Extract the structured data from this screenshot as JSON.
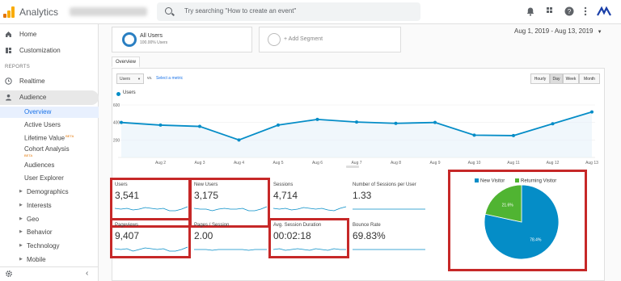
{
  "app": {
    "name": "Analytics"
  },
  "search": {
    "placeholder": "Try searching \"How to create an event\""
  },
  "sidebar": {
    "home": "Home",
    "customization": "Customization",
    "reports_heading": "REPORTS",
    "realtime": "Realtime",
    "audience": "Audience",
    "audience_items": [
      {
        "label": "Overview"
      },
      {
        "label": "Active Users"
      },
      {
        "label": "Lifetime Value",
        "badge": "BETA"
      },
      {
        "label": "Cohort Analysis",
        "badge": "BETA"
      },
      {
        "label": "Audiences"
      },
      {
        "label": "User Explorer"
      },
      {
        "label": "Demographics"
      },
      {
        "label": "Interests"
      },
      {
        "label": "Geo"
      },
      {
        "label": "Behavior"
      },
      {
        "label": "Technology"
      },
      {
        "label": "Mobile"
      }
    ]
  },
  "segments": {
    "all_users": "All Users",
    "all_users_pct": "100.00% Users",
    "add_segment": "+ Add Segment"
  },
  "date_range": "Aug 1, 2019 - Aug 13, 2019",
  "tab_label": "Overview",
  "controls": {
    "metric_dropdown": "Users",
    "vs": "vs.",
    "select_metric": "Select a metric",
    "granularity": [
      "Hourly",
      "Day",
      "Week",
      "Month"
    ],
    "active_granularity": "Day"
  },
  "chart_data": {
    "type": "line",
    "series": [
      {
        "name": "Users",
        "values": [
          400,
          370,
          355,
          200,
          370,
          435,
          405,
          390,
          400,
          255,
          250,
          385,
          520
        ]
      }
    ],
    "x": [
      "Aug 1",
      "Aug 2",
      "Aug 3",
      "Aug 4",
      "Aug 5",
      "Aug 6",
      "Aug 7",
      "Aug 8",
      "Aug 9",
      "Aug 10",
      "Aug 11",
      "Aug 12",
      "Aug 13"
    ],
    "x_tick_labels": [
      "",
      "Aug 2",
      "Aug 3",
      "Aug 4",
      "Aug 5",
      "Aug 6",
      "Aug 7",
      "Aug 8",
      "Aug 9",
      "Aug 10",
      "Aug 11",
      "Aug 12",
      "Aug 13"
    ],
    "y_ticks": [
      600,
      400,
      200
    ],
    "ylim": [
      0,
      600
    ],
    "color": "#058dc7"
  },
  "metrics": [
    {
      "label": "Users",
      "value": "3,541",
      "highlighted": true
    },
    {
      "label": "New Users",
      "value": "3,175",
      "highlighted": true
    },
    {
      "label": "Sessions",
      "value": "4,714",
      "highlighted": false
    },
    {
      "label": "Number of Sessions per User",
      "value": "1.33",
      "highlighted": false
    },
    {
      "label": "Pageviews",
      "value": "9,407",
      "highlighted": true
    },
    {
      "label": "Pages / Session",
      "value": "2.00",
      "highlighted": false
    },
    {
      "label": "Avg. Session Duration",
      "value": "00:02:18",
      "highlighted": true
    },
    {
      "label": "Bounce Rate",
      "value": "69.83%",
      "highlighted": false
    }
  ],
  "pie": {
    "legend": [
      {
        "label": "New Visitor",
        "color": "#058dc7"
      },
      {
        "label": "Returning Visitor",
        "color": "#50b432"
      }
    ],
    "slices": [
      {
        "label": "New Visitor",
        "value": 78.4,
        "text": "78.4%",
        "color": "#058dc7"
      },
      {
        "label": "Returning Visitor",
        "value": 21.6,
        "text": "21.6%",
        "color": "#50b432"
      }
    ]
  },
  "colors": {
    "highlight": "#c62828",
    "accent": "#1a73e8"
  }
}
